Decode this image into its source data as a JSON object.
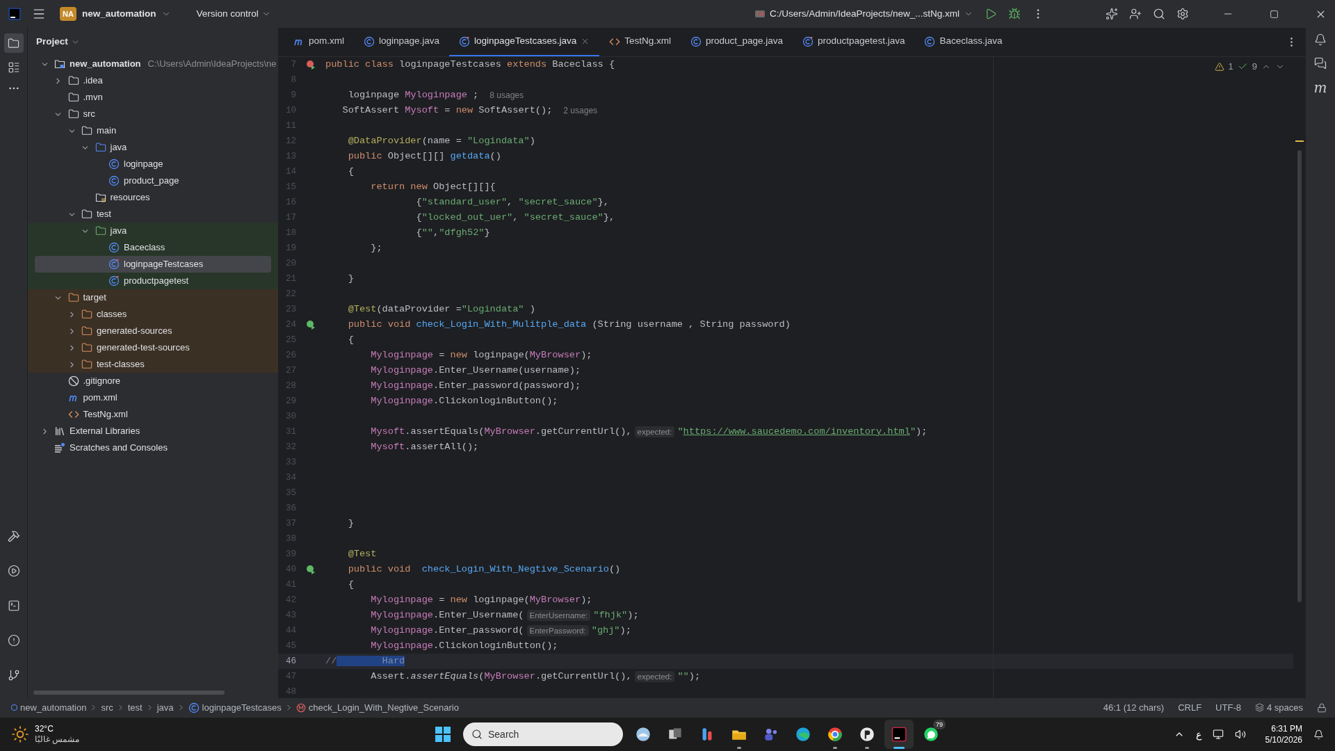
{
  "topbar": {
    "badge": "NA",
    "project": "new_automation",
    "vcs": "Version control",
    "run_config": "C:/Users/Admin/IdeaProjects/new_...stNg.xml"
  },
  "project_panel": {
    "title": "Project",
    "tree": [
      {
        "label": "new_automation",
        "kind": "module",
        "hint": "C:\\Users\\Admin\\IdeaProjects\\ne",
        "expanded": true,
        "selected": false,
        "children": [
          {
            "label": ".idea",
            "kind": "folder",
            "expanded": false,
            "selected": false
          },
          {
            "label": ".mvn",
            "kind": "folder",
            "selected": false
          },
          {
            "label": "src",
            "kind": "folder",
            "expanded": true,
            "selected": false,
            "children": [
              {
                "label": "main",
                "kind": "folder",
                "expanded": true,
                "selected": false,
                "children": [
                  {
                    "label": "java",
                    "kind": "source-folder",
                    "expanded": true,
                    "selected": false,
                    "children": [
                      {
                        "label": "loginpage",
                        "kind": "class",
                        "selected": false
                      },
                      {
                        "label": "product_page",
                        "kind": "class",
                        "selected": false
                      }
                    ]
                  },
                  {
                    "label": "resources",
                    "kind": "resources",
                    "selected": false
                  }
                ]
              },
              {
                "label": "test",
                "kind": "folder",
                "expanded": true,
                "selected": false,
                "children": [
                  {
                    "label": "java",
                    "kind": "test-folder",
                    "expanded": true,
                    "selected": false,
                    "color": "#283629",
                    "children": [
                      {
                        "label": "Baceclass",
                        "kind": "class",
                        "selected": false,
                        "color": "#283629"
                      },
                      {
                        "label": "loginpageTestcases",
                        "kind": "test-class",
                        "selected": true,
                        "color": "#283629"
                      },
                      {
                        "label": "productpagetest",
                        "kind": "test-class",
                        "selected": false,
                        "color": "#283629"
                      }
                    ]
                  }
                ]
              }
            ]
          },
          {
            "label": "target",
            "kind": "excluded-folder",
            "expanded": true,
            "selected": false,
            "color": "#3b3024",
            "children": [
              {
                "label": "classes",
                "kind": "excluded-folder",
                "expanded": false,
                "selected": false,
                "color": "#3b3024"
              },
              {
                "label": "generated-sources",
                "kind": "excluded-folder",
                "expanded": false,
                "selected": false,
                "color": "#3b3024"
              },
              {
                "label": "generated-test-sources",
                "kind": "excluded-folder",
                "expanded": false,
                "selected": false,
                "color": "#3b3024"
              },
              {
                "label": "test-classes",
                "kind": "excluded-folder",
                "expanded": false,
                "selected": false,
                "color": "#3b3024"
              }
            ]
          },
          {
            "label": ".gitignore",
            "kind": "gitignore",
            "selected": false
          },
          {
            "label": "pom.xml",
            "kind": "maven",
            "selected": false
          },
          {
            "label": "TestNg.xml",
            "kind": "xml",
            "selected": false
          }
        ]
      },
      {
        "label": "External Libraries",
        "kind": "library",
        "expanded": false,
        "selected": false
      },
      {
        "label": "Scratches and Consoles",
        "kind": "scratches",
        "selected": false
      }
    ]
  },
  "tabs": [
    {
      "label": "pom.xml",
      "kind": "maven",
      "selected": false
    },
    {
      "label": "loginpage.java",
      "kind": "class",
      "selected": false
    },
    {
      "label": "loginpageTestcases.java",
      "kind": "test-class",
      "selected": true
    },
    {
      "label": "TestNg.xml",
      "kind": "xml",
      "selected": false
    },
    {
      "label": "product_page.java",
      "kind": "class",
      "selected": false
    },
    {
      "label": "productpagetest.java",
      "kind": "test-class",
      "selected": false
    },
    {
      "label": "Baceclass.java",
      "kind": "class",
      "selected": false
    }
  ],
  "inspections": {
    "warnings": "1",
    "checks": "9"
  },
  "right_stripe": {
    "maven_glyph": "m"
  },
  "editor": {
    "lines": [
      {
        "num": "7",
        "gutter_icon": {
          "kind": "run-error"
        },
        "current": false,
        "tokens": [
          {
            "kind": "kw",
            "text": "public class "
          },
          {
            "kind": "plain",
            "text": "loginpageTestcases"
          },
          {
            "kind": "kw",
            "text": " extends "
          },
          {
            "kind": "plain",
            "text": "Baceclass {"
          }
        ]
      },
      {
        "num": "8",
        "current": false
      },
      {
        "num": "9",
        "current": false,
        "tokens": [
          {
            "kind": "plain",
            "text": "    loginpage "
          },
          {
            "kind": "field",
            "text": "Myloginpage"
          },
          {
            "kind": "plain",
            "text": " ;"
          },
          {
            "kind": "usages",
            "text": "8 usages"
          }
        ]
      },
      {
        "num": "10",
        "current": false,
        "tokens": [
          {
            "kind": "plain",
            "text": "   SoftAssert "
          },
          {
            "kind": "field",
            "text": "Mysoft"
          },
          {
            "kind": "plain",
            "text": " = "
          },
          {
            "kind": "kw",
            "text": "new "
          },
          {
            "kind": "plain",
            "text": "SoftAssert();"
          },
          {
            "kind": "usages",
            "text": "2 usages"
          }
        ]
      },
      {
        "num": "11",
        "current": false
      },
      {
        "num": "12",
        "current": false,
        "tokens": [
          {
            "kind": "ann",
            "text": "    @DataProvider"
          },
          {
            "kind": "plain",
            "text": "(name = "
          },
          {
            "kind": "str",
            "text": "\"Logindata\""
          },
          {
            "kind": "plain",
            "text": ")"
          }
        ]
      },
      {
        "num": "13",
        "current": false,
        "tokens": [
          {
            "kind": "kw",
            "text": "    public "
          },
          {
            "kind": "plain",
            "text": "Object[][] "
          },
          {
            "kind": "fn",
            "text": "getdata"
          },
          {
            "kind": "plain",
            "text": "()"
          }
        ]
      },
      {
        "num": "14",
        "current": false,
        "tokens": [
          {
            "kind": "plain",
            "text": "    {"
          }
        ]
      },
      {
        "num": "15",
        "current": false,
        "tokens": [
          {
            "kind": "kw",
            "text": "        return new "
          },
          {
            "kind": "plain",
            "text": "Object[][]{"
          }
        ]
      },
      {
        "num": "16",
        "current": false,
        "tokens": [
          {
            "kind": "plain",
            "text": "                {"
          },
          {
            "kind": "str",
            "text": "\"standard_user\""
          },
          {
            "kind": "plain",
            "text": ", "
          },
          {
            "kind": "str",
            "text": "\"secret_sauce\""
          },
          {
            "kind": "plain",
            "text": "},"
          }
        ]
      },
      {
        "num": "17",
        "current": false,
        "tokens": [
          {
            "kind": "plain",
            "text": "                {"
          },
          {
            "kind": "str",
            "text": "\"locked_out_uer\""
          },
          {
            "kind": "plain",
            "text": ", "
          },
          {
            "kind": "str",
            "text": "\"secret_sauce\""
          },
          {
            "kind": "plain",
            "text": "},"
          }
        ]
      },
      {
        "num": "18",
        "current": false,
        "tokens": [
          {
            "kind": "plain",
            "text": "                {"
          },
          {
            "kind": "str",
            "text": "\"\""
          },
          {
            "kind": "plain",
            "text": ","
          },
          {
            "kind": "str",
            "text": "\"dfgh52\""
          },
          {
            "kind": "plain",
            "text": "}"
          }
        ]
      },
      {
        "num": "19",
        "current": false,
        "tokens": [
          {
            "kind": "plain",
            "text": "        };"
          }
        ]
      },
      {
        "num": "20",
        "current": false
      },
      {
        "num": "21",
        "current": false,
        "tokens": [
          {
            "kind": "plain",
            "text": "    }"
          }
        ]
      },
      {
        "num": "22",
        "current": false
      },
      {
        "num": "23",
        "current": false,
        "tokens": [
          {
            "kind": "ann",
            "text": "    @Test"
          },
          {
            "kind": "plain",
            "text": "(dataProvider ="
          },
          {
            "kind": "str",
            "text": "\"Logindata\""
          },
          {
            "kind": "plain",
            "text": " )"
          }
        ]
      },
      {
        "num": "24",
        "gutter_icon": {
          "kind": "run-passed"
        },
        "current": false,
        "tokens": [
          {
            "kind": "kw",
            "text": "    public void "
          },
          {
            "kind": "fn",
            "text": "check_Login_With_Mulitple_data"
          },
          {
            "kind": "plain",
            "text": " (String username , String password)"
          }
        ]
      },
      {
        "num": "25",
        "current": false,
        "tokens": [
          {
            "kind": "plain",
            "text": "    {"
          }
        ]
      },
      {
        "num": "26",
        "current": false,
        "tokens": [
          {
            "kind": "field",
            "text": "        Myloginpage"
          },
          {
            "kind": "plain",
            "text": " = "
          },
          {
            "kind": "kw",
            "text": "new "
          },
          {
            "kind": "plain",
            "text": "loginpage("
          },
          {
            "kind": "field",
            "text": "MyBrowser"
          },
          {
            "kind": "plain",
            "text": ");"
          }
        ]
      },
      {
        "num": "27",
        "current": false,
        "tokens": [
          {
            "kind": "field",
            "text": "        Myloginpage"
          },
          {
            "kind": "plain",
            "text": ".Enter_Username(username);"
          }
        ]
      },
      {
        "num": "28",
        "current": false,
        "tokens": [
          {
            "kind": "field",
            "text": "        Myloginpage"
          },
          {
            "kind": "plain",
            "text": ".Enter_password(password);"
          }
        ]
      },
      {
        "num": "29",
        "current": false,
        "tokens": [
          {
            "kind": "field",
            "text": "        Myloginpage"
          },
          {
            "kind": "plain",
            "text": ".ClickonloginButton();"
          }
        ]
      },
      {
        "num": "30",
        "current": false
      },
      {
        "num": "31",
        "current": false,
        "tokens": [
          {
            "kind": "field",
            "text": "        Mysoft"
          },
          {
            "kind": "plain",
            "text": ".assertEquals("
          },
          {
            "kind": "field",
            "text": "MyBrowser"
          },
          {
            "kind": "plain",
            "text": ".getCurrentUrl(),"
          },
          {
            "kind": "hint",
            "text": "expected:"
          },
          {
            "kind": "str",
            "text": "\""
          },
          {
            "kind": "link",
            "text": "https://www.saucedemo.com/inventory.html"
          },
          {
            "kind": "str",
            "text": "\""
          },
          {
            "kind": "plain",
            "text": ");"
          }
        ]
      },
      {
        "num": "32",
        "current": false,
        "tokens": [
          {
            "kind": "field",
            "text": "        Mysoft"
          },
          {
            "kind": "plain",
            "text": ".assertAll();"
          }
        ]
      },
      {
        "num": "33",
        "current": false
      },
      {
        "num": "34",
        "current": false
      },
      {
        "num": "35",
        "current": false
      },
      {
        "num": "36",
        "current": false
      },
      {
        "num": "37",
        "current": false,
        "tokens": [
          {
            "kind": "plain",
            "text": "    }"
          }
        ]
      },
      {
        "num": "38",
        "current": false
      },
      {
        "num": "39",
        "current": false,
        "tokens": [
          {
            "kind": "ann",
            "text": "    @Test"
          }
        ]
      },
      {
        "num": "40",
        "gutter_icon": {
          "kind": "run-passed"
        },
        "current": false,
        "tokens": [
          {
            "kind": "kw",
            "text": "    public void  "
          },
          {
            "kind": "fn",
            "text": "check_Login_With_Negtive_Scenario"
          },
          {
            "kind": "plain",
            "text": "()"
          }
        ]
      },
      {
        "num": "41",
        "current": false,
        "tokens": [
          {
            "kind": "plain",
            "text": "    {"
          }
        ]
      },
      {
        "num": "42",
        "current": false,
        "tokens": [
          {
            "kind": "field",
            "text": "        Myloginpage"
          },
          {
            "kind": "plain",
            "text": " = "
          },
          {
            "kind": "kw",
            "text": "new "
          },
          {
            "kind": "plain",
            "text": "loginpage("
          },
          {
            "kind": "field",
            "text": "MyBrowser"
          },
          {
            "kind": "plain",
            "text": ");"
          }
        ]
      },
      {
        "num": "43",
        "current": false,
        "tokens": [
          {
            "kind": "field",
            "text": "        Myloginpage"
          },
          {
            "kind": "plain",
            "text": ".Enter_Username("
          },
          {
            "kind": "hint",
            "text": "EnterUsername:"
          },
          {
            "kind": "str",
            "text": "\"fhjk\""
          },
          {
            "kind": "plain",
            "text": ");"
          }
        ]
      },
      {
        "num": "44",
        "current": false,
        "tokens": [
          {
            "kind": "field",
            "text": "        Myloginpage"
          },
          {
            "kind": "plain",
            "text": ".Enter_password("
          },
          {
            "kind": "hint",
            "text": "EnterPassword:"
          },
          {
            "kind": "str",
            "text": "\"ghj\""
          },
          {
            "kind": "plain",
            "text": ");"
          }
        ]
      },
      {
        "num": "45",
        "current": false,
        "tokens": [
          {
            "kind": "field",
            "text": "        Myloginpage"
          },
          {
            "kind": "plain",
            "text": ".ClickonloginButton();"
          }
        ]
      },
      {
        "num": "46",
        "current": true,
        "tokens": [
          {
            "kind": "comment",
            "text": "//"
          },
          {
            "kind": "sel",
            "text": "        Hard"
          }
        ]
      },
      {
        "num": "47",
        "current": false,
        "tokens": [
          {
            "kind": "plain",
            "text": "        Assert."
          },
          {
            "kind": "italic",
            "text": "assertEquals"
          },
          {
            "kind": "plain",
            "text": "("
          },
          {
            "kind": "field",
            "text": "MyBrowser"
          },
          {
            "kind": "plain",
            "text": ".getCurrentUrl(),"
          },
          {
            "kind": "hint",
            "text": "expected:"
          },
          {
            "kind": "str",
            "text": "\"\""
          },
          {
            "kind": "plain",
            "text": ");"
          }
        ]
      },
      {
        "num": "48",
        "current": false
      }
    ]
  },
  "status_bar": {
    "breadcrumbs": [
      {
        "label": "new_automation",
        "kind": "module"
      },
      {
        "label": "src",
        "kind": "folder"
      },
      {
        "label": "test",
        "kind": "folder"
      },
      {
        "label": "java",
        "kind": "folder"
      },
      {
        "label": "loginpageTestcases",
        "kind": "class"
      },
      {
        "label": "check_Login_With_Negtive_Scenario",
        "kind": "method"
      }
    ],
    "position": "46:1 (12 chars)",
    "line_ending": "CRLF",
    "encoding": "UTF-8",
    "indent": "4 spaces"
  },
  "taskbar": {
    "weather": {
      "temp": "32°C",
      "condition": "مشمس غالبًا"
    },
    "search_placeholder": "Search",
    "apps": [
      {
        "kind": "widget",
        "running": false,
        "active": false
      },
      {
        "kind": "taskview",
        "running": false,
        "active": false
      },
      {
        "kind": "tool",
        "running": false,
        "active": false
      },
      {
        "kind": "folder",
        "running": true,
        "active": false
      },
      {
        "kind": "people",
        "running": false,
        "active": false
      },
      {
        "kind": "browser",
        "running": false,
        "active": false
      },
      {
        "kind": "globe",
        "running": true,
        "active": false
      },
      {
        "kind": "p",
        "running": true,
        "active": false
      },
      {
        "kind": "ide",
        "running": true,
        "active": true
      },
      {
        "kind": "chat",
        "running": false,
        "active": false,
        "badge": "79"
      }
    ],
    "language": "ع",
    "time": "6:31 PM",
    "date": "5/10/2026"
  }
}
